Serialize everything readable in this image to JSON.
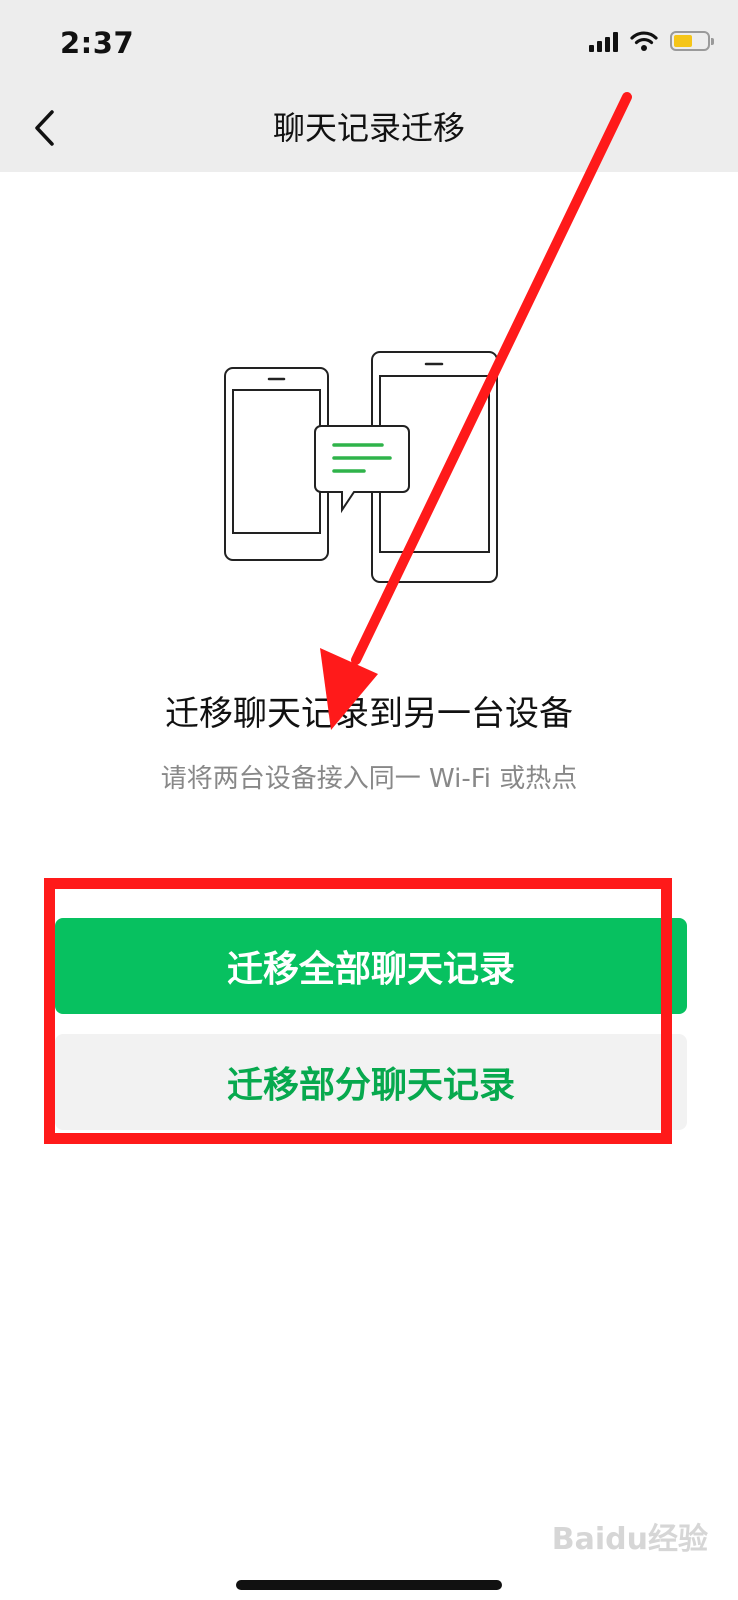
{
  "status_bar": {
    "time": "2:37",
    "battery_color": "#f5c518"
  },
  "header": {
    "back_icon": "chevron-left-icon",
    "title": "聊天记录迁移"
  },
  "content": {
    "illustration_icon": "two-devices-chat-icon",
    "headline": "迁移聊天记录到另一台设备",
    "subtext": "请将两台设备接入同一 Wi-Fi 或热点"
  },
  "actions": {
    "primary_label": "迁移全部聊天记录",
    "secondary_label": "迁移部分聊天记录"
  },
  "watermark": "Baidu经验",
  "colors": {
    "accent": "#07c160",
    "secondary_text": "#07a94e",
    "annotation": "#ff1a1a"
  }
}
